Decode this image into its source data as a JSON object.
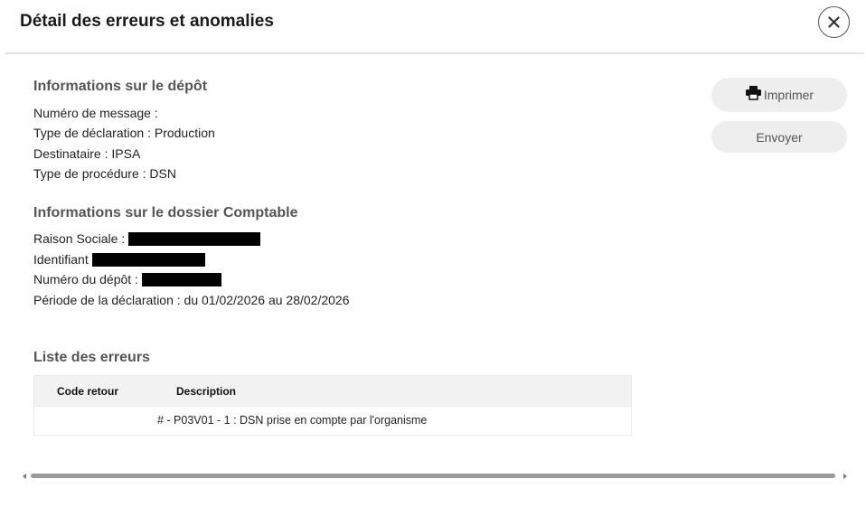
{
  "modal": {
    "title": "Détail des erreurs et anomalies",
    "close_icon": "close-icon"
  },
  "deposit_info": {
    "heading": "Informations sur le dépôt",
    "message_number": "Numéro de message :",
    "declaration_type": "Type de déclaration : Production",
    "recipient": "Destinataire : IPSA",
    "procedure_type": "Type de procédure : DSN"
  },
  "accounting_file": {
    "heading": "Informations sur le dossier Comptable",
    "company_name_label": "Raison Sociale :",
    "identifier_label": "Identifiant",
    "deposit_number_label": "Numéro du dépôt :",
    "declaration_period": "Période de la déclaration : du 01/02/2026 au 28/02/2026"
  },
  "actions": {
    "print_label": "Imprimer",
    "print_icon": "printer-icon",
    "send_label": "Envoyer"
  },
  "errors": {
    "heading": "Liste des erreurs",
    "columns": [
      "Code retour",
      "Description"
    ],
    "rows": [
      {
        "code": "",
        "description": "# - P03V01 - 1 : DSN prise en compte par l'organisme"
      }
    ]
  },
  "colors": {
    "heading_gray": "#555555",
    "button_bg": "#eeeeee",
    "table_header_bg": "#f2f2f2",
    "redaction": "#000000",
    "scrollbar_thumb": "#9a9a9a"
  }
}
